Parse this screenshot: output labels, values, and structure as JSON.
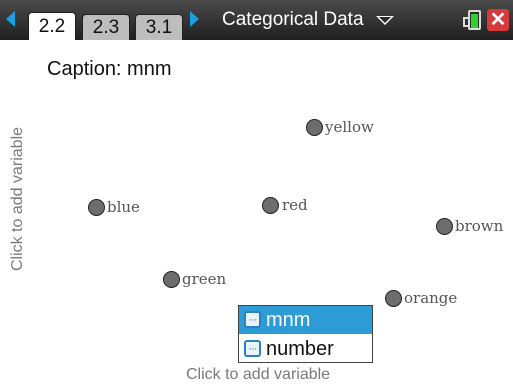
{
  "tabs": [
    {
      "label": "2.2",
      "active": true
    },
    {
      "label": "2.3",
      "active": false
    },
    {
      "label": "3.1",
      "active": false
    }
  ],
  "document": {
    "title": "Categorical Data"
  },
  "icons": {
    "nav_left": "chevron-left-icon",
    "nav_right": "chevron-right-icon",
    "doc_menu": "chevron-down-icon",
    "battery": "battery-icon",
    "close": "close-icon"
  },
  "colors": {
    "nav_arrow": "#1a9fe0",
    "selected_item": "#2c9bd6",
    "battery_fill": "#2fd12f",
    "close": "#d63a3a"
  },
  "plot": {
    "caption": "Caption: mnm",
    "y_axis_prompt": "Click to add variable",
    "x_axis_prompt": "Click to add variable",
    "points": [
      {
        "label": "yellow"
      },
      {
        "label": "blue"
      },
      {
        "label": "red"
      },
      {
        "label": "brown"
      },
      {
        "label": "green"
      },
      {
        "label": "orange"
      }
    ]
  },
  "variable_menu": {
    "items": [
      {
        "label": "mnm",
        "selected": true
      },
      {
        "label": "number",
        "selected": false
      }
    ]
  }
}
